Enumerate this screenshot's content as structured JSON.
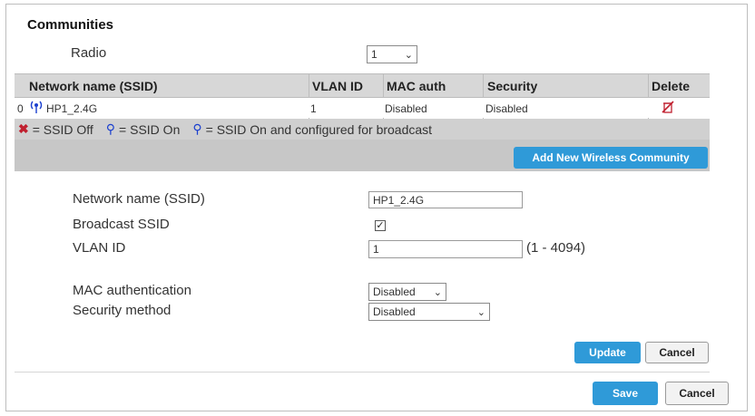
{
  "communities": {
    "title": "Communities",
    "radio_label": "Radio",
    "radio_value": "1"
  },
  "table": {
    "headers": [
      "Network name (SSID)",
      "VLAN ID",
      "MAC auth",
      "Security",
      "Delete"
    ],
    "rows": [
      {
        "index": "0",
        "ssid": "HP1_2.4G",
        "vlan": "1",
        "mac_auth": "Disabled",
        "security": "Disabled"
      }
    ]
  },
  "legend": {
    "off": "= SSID Off",
    "on": "= SSID On",
    "broadcast": "= SSID On and configured for broadcast"
  },
  "actions": {
    "add_label": "Add New Wireless Community"
  },
  "form": {
    "ssid_label": "Network name (SSID)",
    "ssid_value": "HP1_2.4G",
    "broadcast_label": "Broadcast SSID",
    "broadcast_checked": "✓",
    "vlan_label": "VLAN ID",
    "vlan_value": "1",
    "vlan_range": "(1 - 4094)",
    "mac_label": "MAC authentication",
    "mac_value": "Disabled",
    "security_label": "Security method",
    "security_value": "Disabled",
    "update_label": "Update",
    "cancel_label": "Cancel"
  },
  "footer": {
    "save_label": "Save",
    "cancel_label": "Cancel"
  },
  "colors": {
    "accent": "#2f9ad8",
    "header_bg": "#d7d7d7",
    "action_bg": "#c7c7c7",
    "delete": "#c0202f"
  },
  "icons": {
    "ssid_off": "ssid-off-icon",
    "ssid_on": "ssid-on-icon",
    "ssid_broadcast": "ssid-broadcast-icon",
    "delete": "delete-icon"
  }
}
